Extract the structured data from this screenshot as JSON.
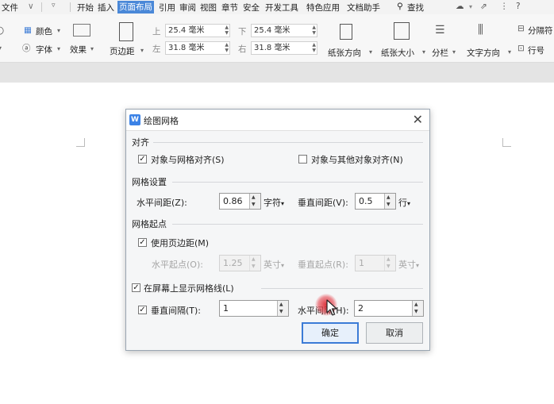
{
  "menubar": {
    "file": "文件",
    "tabs": [
      "开始",
      "插入",
      "页面布局",
      "引用",
      "审阅",
      "视图",
      "章节",
      "安全",
      "开发工具",
      "特色应用",
      "文档助手"
    ],
    "active_tab": "页面布局",
    "search": "查找"
  },
  "toolbar": {
    "color": "颜色",
    "font": "字体",
    "effect": "效果",
    "margin": "页边距",
    "top_label": "上",
    "top_value": "25.4 毫米",
    "bottom_label": "下",
    "bottom_value": "25.4 毫米",
    "left_label": "左",
    "left_value": "31.8 毫米",
    "right_label": "右",
    "right_value": "31.8 毫米",
    "orientation": "纸张方向",
    "size": "纸张大小",
    "columns": "分栏",
    "text_direction": "文字方向",
    "separator": "分隔符",
    "line_number": "行号"
  },
  "dialog": {
    "title": "绘图网格",
    "app_logo": "W",
    "sec_align": "对齐",
    "snap_grid": "对象与网格对齐(S)",
    "snap_grid_checked": true,
    "snap_objects": "对象与其他对象对齐(N)",
    "snap_objects_checked": false,
    "sec_grid": "网格设置",
    "h_spacing_label": "水平间距(Z):",
    "h_spacing_value": "0.86",
    "h_spacing_unit": "字符",
    "v_spacing_label": "垂直间距(V):",
    "v_spacing_value": "0.5",
    "v_spacing_unit": "行",
    "sec_origin": "网格起点",
    "use_margin": "使用页边距(M)",
    "use_margin_checked": true,
    "h_origin_label": "水平起点(O):",
    "h_origin_value": "1.25",
    "h_origin_unit": "英寸",
    "v_origin_label": "垂直起点(R):",
    "v_origin_value": "1",
    "v_origin_unit": "英寸",
    "show_grid": "在屏幕上显示网格线(L)",
    "show_grid_checked": true,
    "v_interval": "垂直间隔(T):",
    "v_interval_checked": true,
    "v_interval_value": "1",
    "h_interval_label": "水平间隔(H):",
    "h_interval_value": "2",
    "ok": "确定",
    "cancel": "取消"
  }
}
